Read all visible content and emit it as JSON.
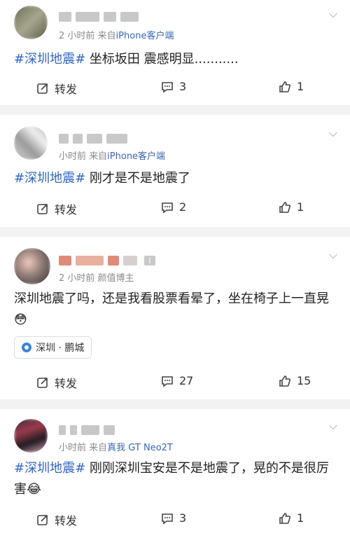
{
  "posts": [
    {
      "meta_time": "2 小时前",
      "meta_source_prefix": "来自",
      "meta_source": "iPhone客户端",
      "tag": "#深圳地震#",
      "text": " 坐标坂田 震感明显...........",
      "repost_label": "转发",
      "comment_count": "3",
      "like_count": "1"
    },
    {
      "meta_time": "小时前",
      "meta_source_prefix": "来自",
      "meta_source": "iPhone客户端",
      "tag": "#深圳地震#",
      "text": " 刚才是不是地震了",
      "repost_label": "转发",
      "comment_count": "2",
      "like_count": "1"
    },
    {
      "meta_time": "2 小时前",
      "meta_source_prefix": "",
      "meta_source": "颜值博主",
      "tag": "",
      "text": "深圳地震了吗，还是我看股票看晕了，坐在椅子上一直晃😳",
      "location": "深圳 · 鹏城",
      "repost_label": "转发",
      "comment_count": "27",
      "like_count": "15"
    },
    {
      "meta_time": "小时前",
      "meta_source_prefix": "来自",
      "meta_source": "真我 GT Neo2T",
      "tag": "#深圳地震#",
      "text": " 刚刚深圳宝安是不是地震了，晃的不是很厉害😂",
      "repost_label": "转发",
      "comment_count": "3",
      "like_count": "1"
    }
  ],
  "badge_letter": "I",
  "icons": {
    "repost": "share-icon",
    "comment": "comment-icon",
    "like": "thumbs-up-icon",
    "more": "chevron-down-icon"
  }
}
